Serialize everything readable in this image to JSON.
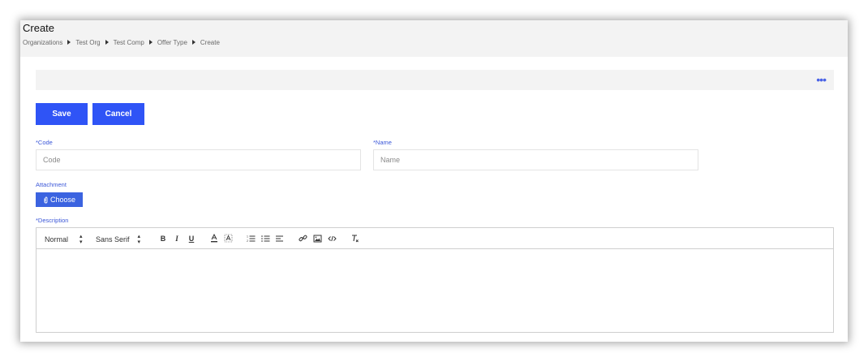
{
  "header": {
    "title": "Create",
    "breadcrumb": [
      "Organizations",
      "Test Org",
      "Test Comp",
      "Offer Type",
      "Create"
    ]
  },
  "actions": {
    "save_label": "Save",
    "cancel_label": "Cancel"
  },
  "form": {
    "code_label": "*Code",
    "code_placeholder": "Code",
    "code_value": "",
    "name_label": "*Name",
    "name_placeholder": "Name",
    "name_value": "",
    "attachment_label": "Attachment",
    "choose_label": "Choose",
    "description_label": "*Description"
  },
  "editor": {
    "format_value": "Normal",
    "font_value": "Sans Serif",
    "icons": [
      "bold-icon",
      "italic-icon",
      "underline-icon",
      "text-color-icon",
      "background-color-icon",
      "ordered-list-icon",
      "bullet-list-icon",
      "align-icon",
      "link-icon",
      "image-icon",
      "code-icon",
      "clear-format-icon"
    ]
  },
  "colors": {
    "accent": "#2f54f6",
    "label": "#3b57d8",
    "header_bg": "#f3f3f3"
  }
}
